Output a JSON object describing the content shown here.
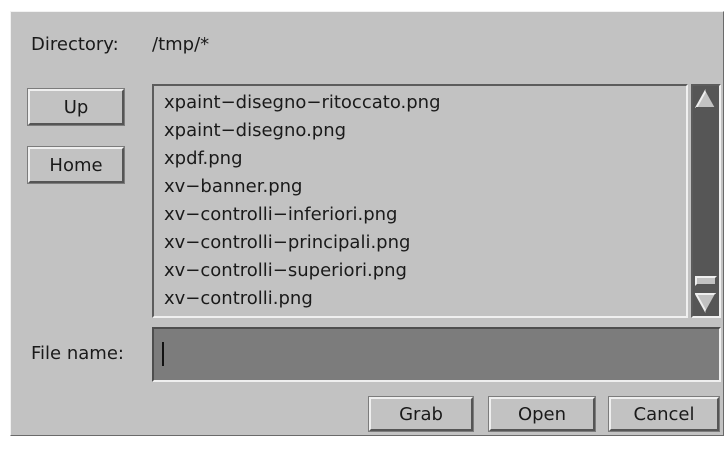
{
  "directory": {
    "label": "Directory:",
    "path": "/tmp/*"
  },
  "nav": {
    "up_label": "Up",
    "home_label": "Home"
  },
  "files": [
    "xpaint−disegno−ritoccato.png",
    "xpaint−disegno.png",
    "xpdf.png",
    "xv−banner.png",
    "xv−controlli−inferiori.png",
    "xv−controlli−principali.png",
    "xv−controlli−superiori.png",
    "xv−controlli.png"
  ],
  "scrollbar": {
    "up_icon": "triangle-up-icon",
    "down_icon": "triangle-down-icon"
  },
  "filename": {
    "label": "File name:",
    "value": ""
  },
  "actions": {
    "grab_label": "Grab",
    "open_label": "Open",
    "cancel_label": "Cancel"
  },
  "colors": {
    "panel": "#c2c2c2",
    "input_bg": "#7c7c7c",
    "scroll_trough": "#565656"
  }
}
